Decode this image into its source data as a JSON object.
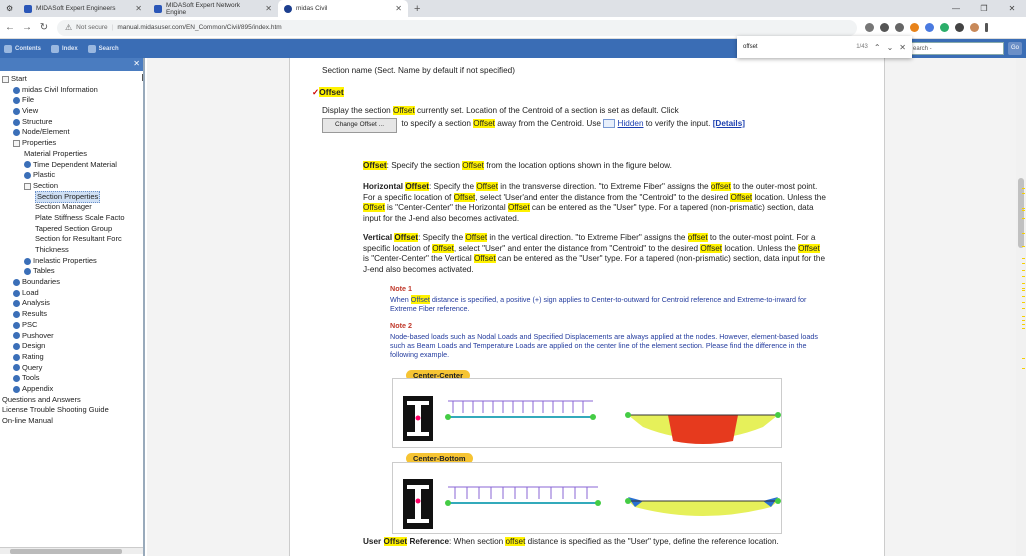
{
  "browser": {
    "tabs": [
      {
        "title": "MIDASoft Expert Engineers",
        "active": false
      },
      {
        "title": "MIDASoft Expert Network Engine",
        "active": false
      },
      {
        "title": "midas Civil",
        "active": true
      }
    ],
    "new_tab": "+",
    "window_controls": [
      "—",
      "❐",
      "✕"
    ],
    "security": "Not secure",
    "url": "manual.midasuser.com/EN_Common/Civil/895/index.htm",
    "find": {
      "query": "offset",
      "count": "1/43"
    }
  },
  "apptoolbar": {
    "contents": "Contents",
    "index": "Index",
    "search": "Search",
    "search_box": "earch -"
  },
  "tree": [
    {
      "label": "Start",
      "level": 0,
      "icon": "open"
    },
    {
      "label": "midas Civil Information",
      "level": 1,
      "icon": "book"
    },
    {
      "label": "File",
      "level": 1,
      "icon": "book"
    },
    {
      "label": "View",
      "level": 1,
      "icon": "book"
    },
    {
      "label": "Structure",
      "level": 1,
      "icon": "book"
    },
    {
      "label": "Node/Element",
      "level": 1,
      "icon": "book"
    },
    {
      "label": "Properties",
      "level": 1,
      "icon": "open"
    },
    {
      "label": "Material Properties",
      "level": 2,
      "icon": "page"
    },
    {
      "label": "Time Dependent Material",
      "level": 2,
      "icon": "book"
    },
    {
      "label": "Plastic",
      "level": 2,
      "icon": "book"
    },
    {
      "label": "Section",
      "level": 2,
      "icon": "open"
    },
    {
      "label": "Section Properties",
      "level": 3,
      "icon": "page",
      "selected": true
    },
    {
      "label": "Section Manager",
      "level": 3,
      "icon": "page"
    },
    {
      "label": "Plate Stiffness Scale Facto",
      "level": 3,
      "icon": "page"
    },
    {
      "label": "Tapered Section Group",
      "level": 3,
      "icon": "page"
    },
    {
      "label": "Section for Resultant Forc",
      "level": 3,
      "icon": "page"
    },
    {
      "label": "Thickness",
      "level": 3,
      "icon": "page"
    },
    {
      "label": "Inelastic Properties",
      "level": 2,
      "icon": "book"
    },
    {
      "label": "Tables",
      "level": 2,
      "icon": "book"
    },
    {
      "label": "Boundaries",
      "level": 1,
      "icon": "book"
    },
    {
      "label": "Load",
      "level": 1,
      "icon": "book"
    },
    {
      "label": "Analysis",
      "level": 1,
      "icon": "book"
    },
    {
      "label": "Results",
      "level": 1,
      "icon": "book"
    },
    {
      "label": "PSC",
      "level": 1,
      "icon": "book"
    },
    {
      "label": "Pushover",
      "level": 1,
      "icon": "book"
    },
    {
      "label": "Design",
      "level": 1,
      "icon": "book"
    },
    {
      "label": "Rating",
      "level": 1,
      "icon": "book"
    },
    {
      "label": "Query",
      "level": 1,
      "icon": "book"
    },
    {
      "label": "Tools",
      "level": 1,
      "icon": "book"
    },
    {
      "label": "Appendix",
      "level": 1,
      "icon": "book"
    },
    {
      "label": "Questions and Answers",
      "level": 0,
      "icon": "page"
    },
    {
      "label": "License Trouble Shooting Guide",
      "level": 0,
      "icon": "page"
    },
    {
      "label": "On-line Manual",
      "level": 0,
      "icon": "page"
    }
  ],
  "content": {
    "section_name": "Section name (Sect. Name by default if not specified)",
    "offset_heading": "Offset",
    "display_a": "Display the section",
    "display_hl": "Offset",
    "display_b": "currently set. Location of the Centroid of a section is set as default. Click",
    "change_btn": "Change Offset ...",
    "specify_a": "to specify a section",
    "specify_hl": "Offset",
    "specify_b": "away from the Centroid. Use",
    "hidden_link": "Hidden",
    "verify": "to verify the input.",
    "details": "[Details]",
    "p1": {
      "hl1": "Offset",
      "t1": ": Specify the section",
      "hl2": "Offset",
      "t2": "from the location options shown in the figure below."
    },
    "horiz": {
      "lead": "Horizontal",
      "lead_hl": "Offset",
      "l1a": ": Specify the",
      "l1hl": "Offset",
      "l1b": "in the transverse direction. \"to Extreme Fiber\" assigns the",
      "l1hl2": "offset",
      "l1c": "to the outer-most point.",
      "l2a": "For a specific location of",
      "l2hl": "Offset",
      "l2b": ", select 'User'and enter the distance from the \"Centroid\" to the desired",
      "l2hl2": "Offset",
      "l2c": "location. Unless the",
      "l3hl": "Offset",
      "l3a": "is \"Center-Center\" the Horizontal",
      "l3hl2": "Offset",
      "l3b": "can be entered as the \"User\" type. For a tapered (non-prismatic) section, data",
      "l4": "input for the J-end also becomes activated."
    },
    "vert": {
      "lead": "Vertical",
      "lead_hl": "Offset",
      "l1a": ": Specify the",
      "l1hl": "Offset",
      "l1b": "in the vertical direction. \"to Extreme Fiber\" assigns the",
      "l1hl2": "offset",
      "l1c": "to the outer-most point. For a",
      "l2a": "specific location of",
      "l2hl": "Offset",
      "l2b": ", select \"User\" and enter the distance from \"Centroid\" to the desired",
      "l2hl2": "Offset",
      "l2c": "location. Unless the",
      "l2hl3": "Offset",
      "l3a": "is \"Center-Center\" the Vertical",
      "l3hl": "Offset",
      "l3b": "can be entered as the \"User\" type. For a tapered (non-prismatic) section, data input for the",
      "l4": "J-end also becomes activated."
    },
    "note1": {
      "title": "Note 1",
      "a": "When",
      "hl": "Offset",
      "b": "distance is specified, a positive (+) sign applies to Center-to-outward for Centroid reference and Extreme-to-inward for",
      "c": "Extreme Fiber reference."
    },
    "note2": {
      "title": "Note 2",
      "l1": "Node-based loads such as Nodal Loads and Specified Displacements are always applied at the nodes. However, element-based loads",
      "l2": "such as Beam Loads and Temperature Loads are applied on the center line of the element section. Please find the difference in the",
      "l3": "following example."
    },
    "fig1_label": "Center-Center",
    "fig2_label": "Center-Bottom",
    "user_ref": {
      "a": "User",
      "hl": "Offset",
      "b": "Reference",
      "c": ": When section",
      "hl2": "offset",
      "d": "distance is specified as the \"User\" type, define the reference location."
    }
  },
  "colors": {
    "highlight": "#fff200",
    "toolbar": "#3a6db5",
    "link": "#1b3fb0",
    "note": "#243c9e"
  }
}
